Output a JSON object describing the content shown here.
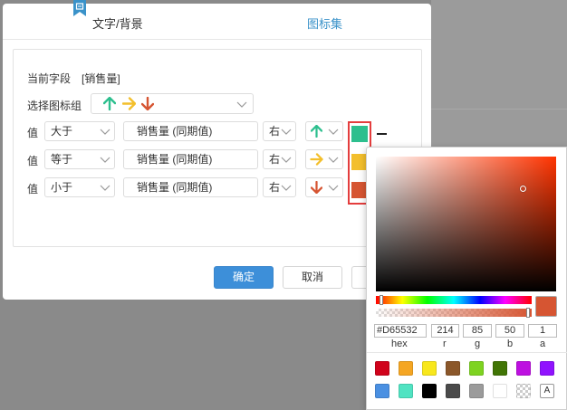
{
  "tabs": [
    {
      "label": "文字/背景",
      "active": false
    },
    {
      "label": "图标集",
      "active": true
    }
  ],
  "form": {
    "current_field_label": "当前字段",
    "current_field_value": "[销售量]",
    "icon_group_label": "选择图标组",
    "icon_group_icons": [
      "arrow-up-green-icon",
      "arrow-right-yellow-icon",
      "arrow-down-orange-icon"
    ],
    "rows": [
      {
        "prefix": "值",
        "operator": "大于",
        "field": "销售量 (同期值)",
        "side": "右",
        "icon": "arrow-up-green-icon",
        "color": "#2dbf8e"
      },
      {
        "prefix": "值",
        "operator": "等于",
        "field": "销售量 (同期值)",
        "side": "右",
        "icon": "arrow-right-yellow-icon",
        "color": "#f3bf2c"
      },
      {
        "prefix": "值",
        "operator": "小于",
        "field": "销售量 (同期值)",
        "side": "右",
        "icon": "arrow-down-orange-icon",
        "color": "#d65532"
      }
    ]
  },
  "buttons": {
    "ok": "确定",
    "cancel": "取消"
  },
  "color_picker": {
    "hex": "#D65532",
    "r": "214",
    "g": "85",
    "b": "50",
    "a": "1",
    "labels": {
      "hex": "hex",
      "r": "r",
      "g": "g",
      "b": "b",
      "a": "a"
    },
    "presets_row1": [
      "#d0021b",
      "#f5a623",
      "#f8e71c",
      "#8b572a",
      "#7ed321",
      "#417505",
      "#bd10e0",
      "#9013fe"
    ],
    "presets_row2": [
      "#4a90e2",
      "#50e3c2",
      "#000000",
      "#4a4a4a",
      "#9b9b9b",
      "#ffffff",
      "transparent",
      "A"
    ]
  },
  "colors": {
    "accent": "#3a92c9",
    "primary_button": "#3d8fd9",
    "highlight_frame": "#e43d3d"
  }
}
